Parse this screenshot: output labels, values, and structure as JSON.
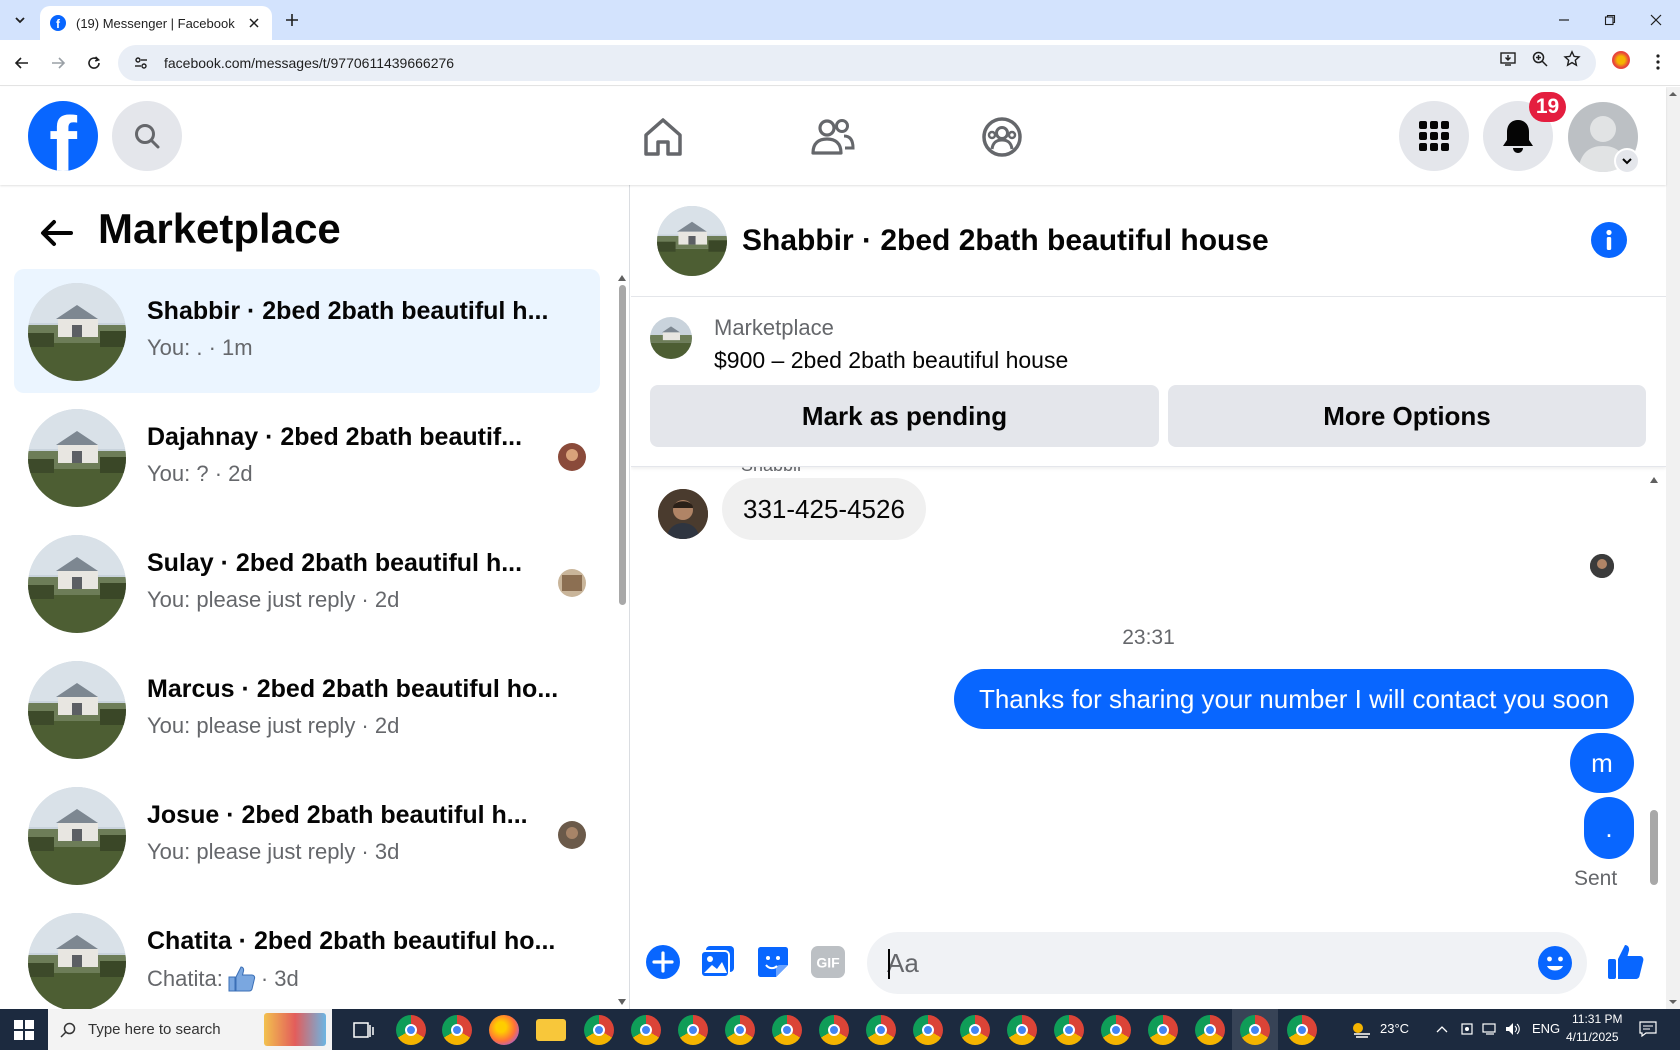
{
  "browser": {
    "tab_title": "(19) Messenger | Facebook",
    "url": "facebook.com/messages/t/9770611439666276"
  },
  "header": {
    "notification_count": "19"
  },
  "sidebar": {
    "title": "Marketplace",
    "threads": [
      {
        "name": "Shabbir · 2bed 2bath beautiful h...",
        "preview": "You: . · 1m",
        "active": true
      },
      {
        "name": "Dajahnay · 2bed 2bath beautif...",
        "preview": "You: ? · 2d"
      },
      {
        "name": "Sulay · 2bed 2bath beautiful h...",
        "preview": "You: please just reply · 2d"
      },
      {
        "name": "Marcus · 2bed 2bath beautiful ho...",
        "preview": "You: please just reply · 2d"
      },
      {
        "name": "Josue · 2bed 2bath beautiful h...",
        "preview": "You: please just reply · 3d"
      },
      {
        "name": "Chatita · 2bed 2bath beautiful ho...",
        "preview_prefix": "Chatita:",
        "preview_suffix": "· 3d"
      }
    ]
  },
  "conversation": {
    "title": "Shabbir · 2bed 2bath beautiful house",
    "listing": {
      "label": "Marketplace",
      "price_title": "$900 – 2bed 2bath beautiful house",
      "mark_pending_label": "Mark as pending",
      "more_options_label": "More Options"
    },
    "sender_name_cut": "Shabbir",
    "incoming_message": "331-425-4526",
    "timestamp": "23:31",
    "outgoing_messages": [
      "Thanks for sharing your number I will contact you soon",
      "m",
      "."
    ],
    "status": "Sent",
    "composer_placeholder": "Aa",
    "gif_label": "GIF"
  },
  "taskbar": {
    "search_placeholder": "Type here to search",
    "weather": "23°C",
    "language": "ENG",
    "time": "11:31 PM",
    "date": "4/11/2025"
  },
  "colors": {
    "fb_blue": "#0866ff",
    "active_thread_bg": "#ebf5ff",
    "badge_red": "#e41e3f",
    "tab_strip": "#d3e3fd"
  }
}
